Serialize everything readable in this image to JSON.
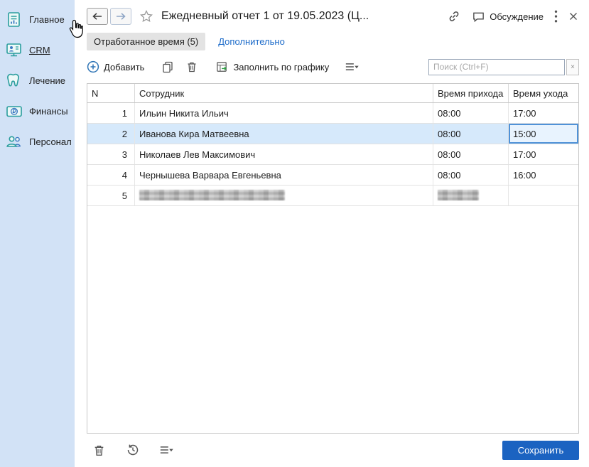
{
  "colors": {
    "accent": "#1b63c1",
    "sidebar_bg": "#d2e2f6",
    "selected_row": "#d6e9fb",
    "editing_border": "#4f92d8",
    "link": "#1b6ac9",
    "icon_teal": "#2a9d9d"
  },
  "sidebar": {
    "items": [
      {
        "label": "Главное",
        "icon": "main-section-icon"
      },
      {
        "label": "CRM",
        "icon": "crm-section-icon",
        "hovered": true
      },
      {
        "label": "Лечение",
        "icon": "treatment-section-icon"
      },
      {
        "label": "Финансы",
        "icon": "finance-section-icon"
      },
      {
        "label": "Персонал",
        "icon": "staff-section-icon"
      }
    ]
  },
  "header": {
    "title": "Ежедневный отчет 1 от 19.05.2023 (Ц...",
    "discussion_label": "Обсуждение"
  },
  "tabs": [
    {
      "label": "Отработанное время (5)",
      "active": true
    },
    {
      "label": "Дополнительно",
      "active": false
    }
  ],
  "toolbar": {
    "add_label": "Добавить",
    "fill_by_schedule_label": "Заполнить по графику",
    "search_placeholder": "Поиск (Ctrl+F)",
    "search_value": "",
    "clear_label": "×"
  },
  "table": {
    "columns": [
      "N",
      "Сотрудник",
      "Время прихода",
      "Время ухода"
    ],
    "rows": [
      {
        "n": "1",
        "employee": "Ильин Никита Ильич",
        "arrival": "08:00",
        "departure": "17:00"
      },
      {
        "n": "2",
        "employee": "Иванова Кира Матвеевна",
        "arrival": "08:00",
        "departure": "15:00",
        "selected": true,
        "editing_cell": "departure"
      },
      {
        "n": "3",
        "employee": "Николаев Лев Максимович",
        "arrival": "08:00",
        "departure": "17:00"
      },
      {
        "n": "4",
        "employee": "Чернышева Варвара Евгеньевна",
        "arrival": "08:00",
        "departure": "16:00"
      },
      {
        "n": "5",
        "employee": "",
        "arrival": "",
        "departure": "",
        "redacted": true
      }
    ]
  },
  "footer": {
    "save_label": "Сохранить"
  }
}
